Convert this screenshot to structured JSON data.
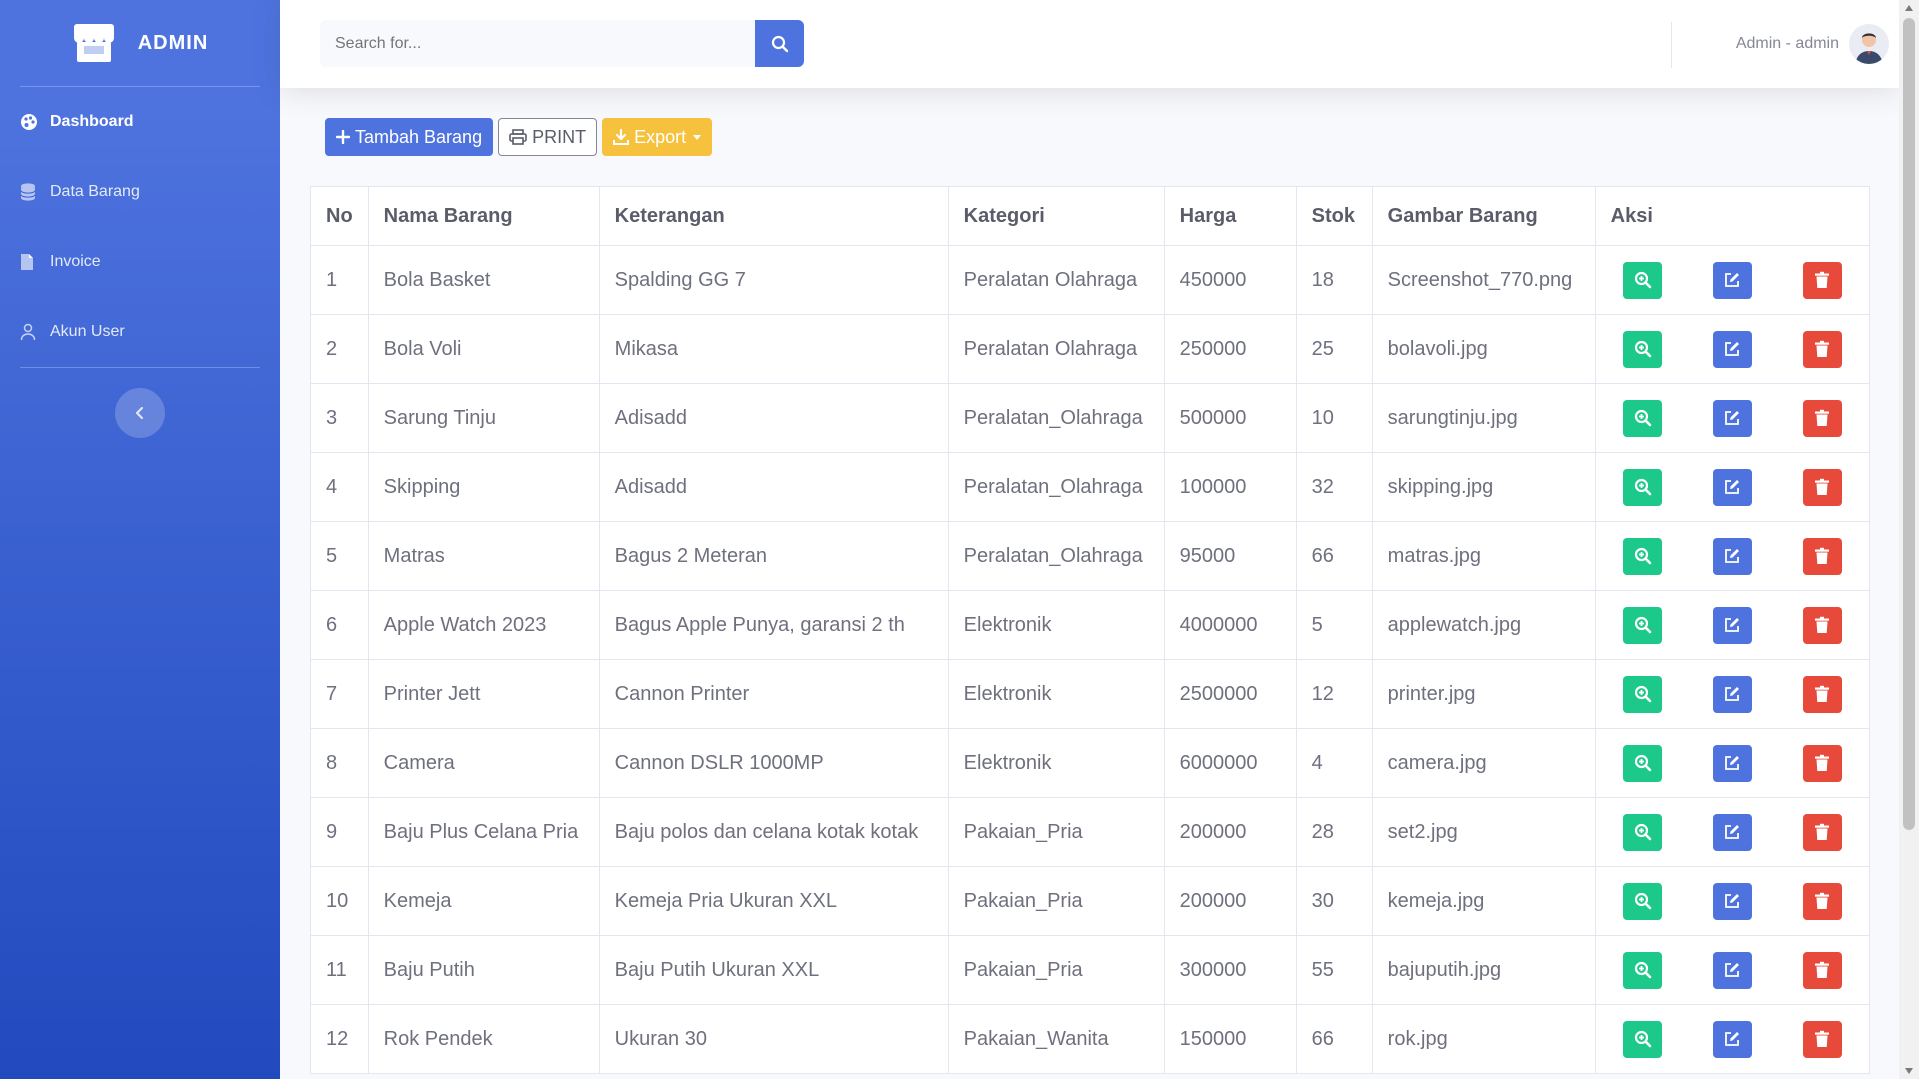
{
  "sidebar": {
    "brand": "ADMIN",
    "items": [
      {
        "label": "Dashboard",
        "icon": "palette-icon",
        "active": true
      },
      {
        "label": "Data Barang",
        "icon": "database-icon",
        "active": false
      },
      {
        "label": "Invoice",
        "icon": "file-icon",
        "active": false
      },
      {
        "label": "Akun User",
        "icon": "user-icon",
        "active": false
      }
    ]
  },
  "topbar": {
    "search_placeholder": "Search for...",
    "user_label": "Admin - admin"
  },
  "toolbar": {
    "add_label": "Tambah Barang",
    "print_label": "PRINT",
    "export_label": "Export"
  },
  "table": {
    "headers": [
      "No",
      "Nama Barang",
      "Keterangan",
      "Kategori",
      "Harga",
      "Stok",
      "Gambar Barang",
      "Aksi"
    ],
    "rows": [
      [
        "1",
        "Bola Basket",
        "Spalding GG 7",
        "Peralatan Olahraga",
        "450000",
        "18",
        "Screenshot_770.png"
      ],
      [
        "2",
        "Bola Voli",
        "Mikasa",
        "Peralatan Olahraga",
        "250000",
        "25",
        "bolavoli.jpg"
      ],
      [
        "3",
        "Sarung Tinju",
        "Adisadd",
        "Peralatan_Olahraga",
        "500000",
        "10",
        "sarungtinju.jpg"
      ],
      [
        "4",
        "Skipping",
        "Adisadd",
        "Peralatan_Olahraga",
        "100000",
        "32",
        "skipping.jpg"
      ],
      [
        "5",
        "Matras",
        "Bagus 2 Meteran",
        "Peralatan_Olahraga",
        "95000",
        "66",
        "matras.jpg"
      ],
      [
        "6",
        "Apple Watch 2023",
        "Bagus Apple Punya, garansi 2 th",
        "Elektronik",
        "4000000",
        "5",
        "applewatch.jpg"
      ],
      [
        "7",
        "Printer Jett",
        "Cannon Printer",
        "Elektronik",
        "2500000",
        "12",
        "printer.jpg"
      ],
      [
        "8",
        "Camera",
        "Cannon DSLR 1000MP",
        "Elektronik",
        "6000000",
        "4",
        "camera.jpg"
      ],
      [
        "9",
        "Baju Plus Celana Pria",
        "Baju polos dan celana kotak kotak",
        "Pakaian_Pria",
        "200000",
        "28",
        "set2.jpg"
      ],
      [
        "10",
        "Kemeja",
        "Kemeja Pria Ukuran XXL",
        "Pakaian_Pria",
        "200000",
        "30",
        "kemeja.jpg"
      ],
      [
        "11",
        "Baju Putih",
        "Baju Putih Ukuran XXL",
        "Pakaian_Pria",
        "300000",
        "55",
        "bajuputih.jpg"
      ],
      [
        "12",
        "Rok Pendek",
        "Ukuran 30",
        "Pakaian_Wanita",
        "150000",
        "66",
        "rok.jpg"
      ]
    ]
  },
  "colors": {
    "primary": "#4e73df",
    "success": "#1cc88a",
    "danger": "#e74a3b",
    "warning": "#f6c23e"
  }
}
